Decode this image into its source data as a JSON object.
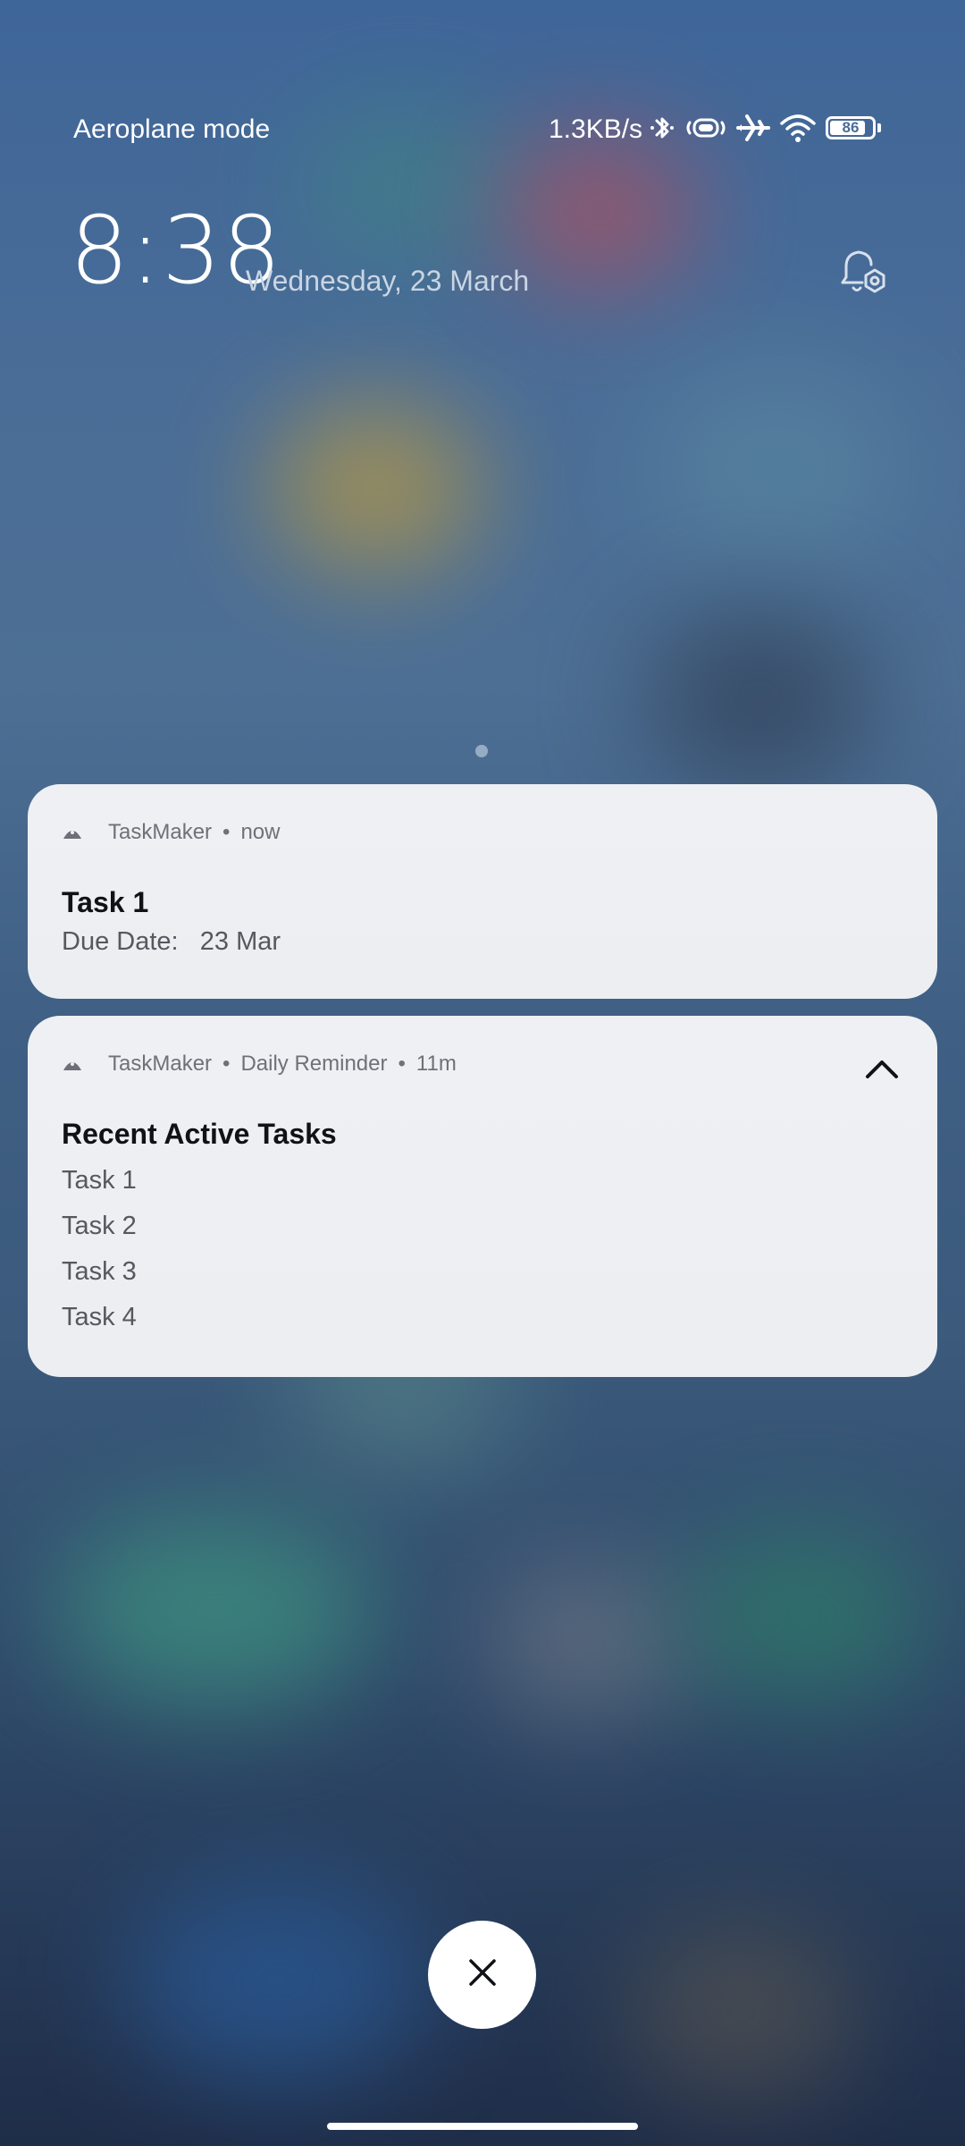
{
  "status_bar": {
    "carrier": "Aeroplane mode",
    "net_speed": "1.3KB/s",
    "battery_level": "86",
    "icons": [
      "bluetooth-icon",
      "vibrate-icon",
      "airplane-icon",
      "wifi-icon",
      "battery-icon"
    ]
  },
  "lockscreen": {
    "time": "8:38",
    "date": "Wednesday, 23 March",
    "settings_icon": "notification-settings-icon"
  },
  "notifications": [
    {
      "app_name": "TaskMaker",
      "time": "now",
      "title": "Task 1",
      "body_label": "Due Date:",
      "body_value": "23 Mar"
    },
    {
      "app_name": "TaskMaker",
      "channel": "Daily Reminder",
      "time": "11m",
      "title": "Recent Active Tasks",
      "items": [
        "Task 1",
        "Task 2",
        "Task 3",
        "Task 4"
      ],
      "expand_icon": "chevron-up-icon"
    }
  ],
  "controls": {
    "dismiss_icon": "close-icon"
  },
  "colors": {
    "card_background": "#eceef2",
    "title_text": "#111216",
    "body_text": "#55585e",
    "meta_text": "#6e7178"
  }
}
